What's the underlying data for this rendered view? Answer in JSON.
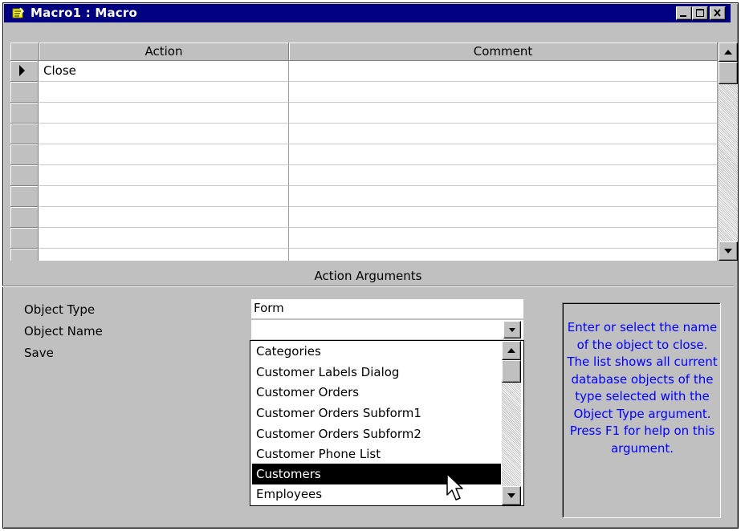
{
  "window": {
    "title": "Macro1 : Macro",
    "colors": {
      "titlebar": "#000080",
      "selection": "#000000",
      "help_text": "#0000ff",
      "face": "#c0c0c0"
    }
  },
  "grid": {
    "columns": [
      "Action",
      "Comment"
    ],
    "rows": [
      {
        "action": "Close",
        "comment": ""
      },
      {
        "action": "",
        "comment": ""
      },
      {
        "action": "",
        "comment": ""
      },
      {
        "action": "",
        "comment": ""
      },
      {
        "action": "",
        "comment": ""
      },
      {
        "action": "",
        "comment": ""
      },
      {
        "action": "",
        "comment": ""
      },
      {
        "action": "",
        "comment": ""
      },
      {
        "action": "",
        "comment": ""
      },
      {
        "action": "",
        "comment": ""
      }
    ],
    "current_row_indicator": "row-selector-arrow-icon"
  },
  "arguments": {
    "section_title": "Action Arguments",
    "object_type_label": "Object Type",
    "object_type_value": "Form",
    "object_name_label": "Object Name",
    "object_name_value": "",
    "save_label": "Save",
    "dropdown_options": [
      "Categories",
      "Customer Labels Dialog",
      "Customer Orders",
      "Customer Orders Subform1",
      "Customer Orders Subform2",
      "Customer Phone List",
      "Customers",
      "Employees"
    ],
    "highlighted_option": "Customers"
  },
  "help": {
    "text": "Enter or select the name of the object to close. The list shows all current database objects of the type selected with the Object Type argument. Press F1 for help on this argument."
  }
}
